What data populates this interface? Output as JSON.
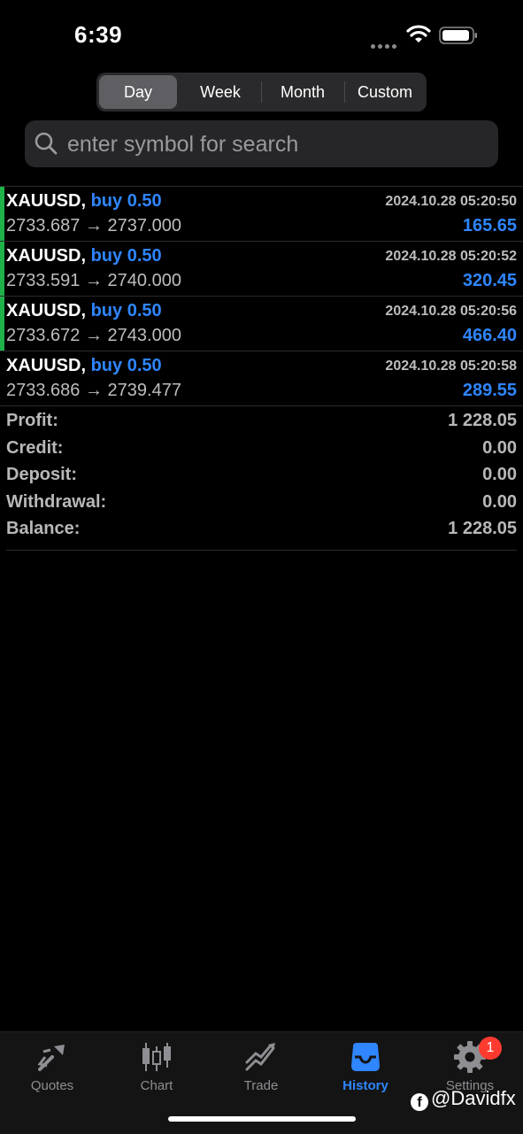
{
  "status": {
    "time": "6:39"
  },
  "periods": {
    "items": [
      "Day",
      "Week",
      "Month",
      "Custom"
    ],
    "active": "Day"
  },
  "search": {
    "placeholder": "enter symbol for search"
  },
  "deals": [
    {
      "symbol": "XAUUSD,",
      "side": "buy 0.50",
      "prices": "2733.687 → 2737.000",
      "date": "2024.10.28 05:20:50",
      "profit": "165.65",
      "marker": true
    },
    {
      "symbol": "XAUUSD,",
      "side": "buy 0.50",
      "prices": "2733.591 → 2740.000",
      "date": "2024.10.28 05:20:52",
      "profit": "320.45",
      "marker": true
    },
    {
      "symbol": "XAUUSD,",
      "side": "buy 0.50",
      "prices": "2733.672 → 2743.000",
      "date": "2024.10.28 05:20:56",
      "profit": "466.40",
      "marker": true
    },
    {
      "symbol": "XAUUSD,",
      "side": "buy 0.50",
      "prices": "2733.686 → 2739.477",
      "date": "2024.10.28 05:20:58",
      "profit": "289.55",
      "marker": false
    }
  ],
  "summary": {
    "profit_label": "Profit:",
    "profit_value": "1 228.05",
    "credit_label": "Credit:",
    "credit_value": "0.00",
    "deposit_label": "Deposit:",
    "deposit_value": "0.00",
    "withdrawal_label": "Withdrawal:",
    "withdrawal_value": "0.00",
    "balance_label": "Balance:",
    "balance_value": "1 228.05"
  },
  "tabs": [
    {
      "label": "Quotes",
      "icon": "quotes-icon"
    },
    {
      "label": "Chart",
      "icon": "chart-icon"
    },
    {
      "label": "Trade",
      "icon": "trade-icon"
    },
    {
      "label": "History",
      "icon": "history-icon",
      "active": true
    },
    {
      "label": "Settings",
      "icon": "gear-icon"
    }
  ],
  "settings_badge": "1",
  "watermark": "@Davidfx",
  "colors": {
    "accent": "#2f86ff",
    "buy_marker": "#1fb24a",
    "badge": "#ff3b30"
  }
}
